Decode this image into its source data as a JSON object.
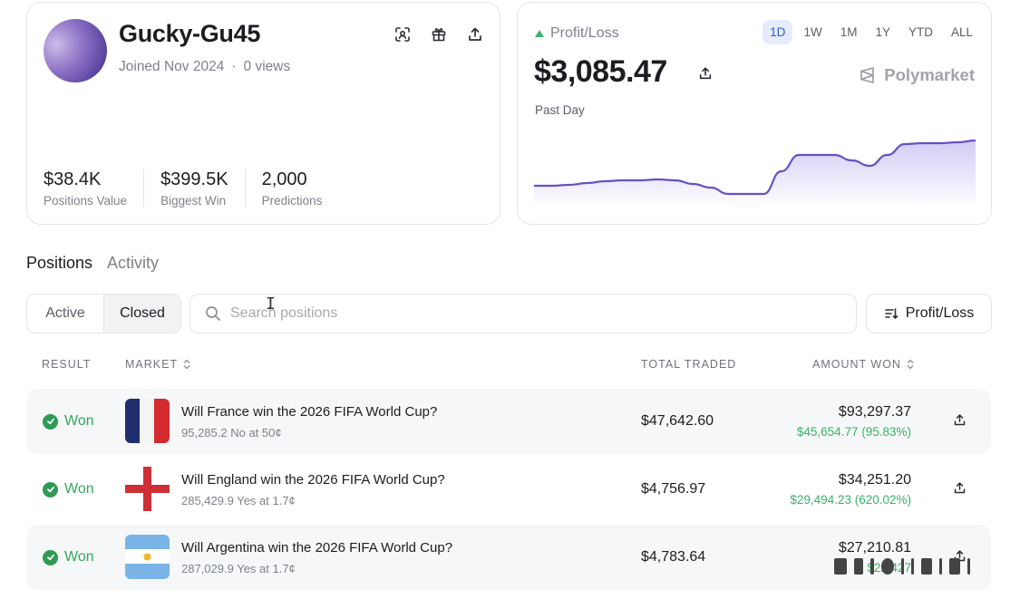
{
  "profile": {
    "username": "Gucky-Gu45",
    "joined": "Joined Nov 2024",
    "separator": "·",
    "views": "0 views",
    "header_icons": [
      "scan-icon",
      "gift-icon",
      "share-icon"
    ],
    "stats": [
      {
        "value": "$38.4K",
        "label": "Positions Value"
      },
      {
        "value": "$399.5K",
        "label": "Biggest Win"
      },
      {
        "value": "2,000",
        "label": "Predictions"
      }
    ]
  },
  "pnl": {
    "label": "Profit/Loss",
    "ranges": [
      "1D",
      "1W",
      "1M",
      "1Y",
      "YTD",
      "ALL"
    ],
    "active_range": "1D",
    "value": "$3,085.47",
    "period": "Past Day",
    "brand": "Polymarket",
    "line_color": "#6a4fc3",
    "sparkline": [
      24,
      24,
      25,
      27,
      29,
      30,
      30,
      31,
      30,
      26,
      22,
      15,
      15,
      15,
      40,
      58,
      58,
      58,
      52,
      46,
      58,
      70,
      71,
      71,
      72,
      74
    ]
  },
  "tabs": {
    "positions": "Positions",
    "activity": "Activity"
  },
  "filter": {
    "active": "Active",
    "closed": "Closed",
    "selected": "Closed"
  },
  "search": {
    "placeholder": "Search positions"
  },
  "sort": {
    "label": "Profit/Loss"
  },
  "table": {
    "headers": {
      "result": "RESULT",
      "market": "MARKET",
      "total_traded": "TOTAL TRADED",
      "amount_won": "AMOUNT WON"
    },
    "rows": [
      {
        "result": "Won",
        "flag": "france",
        "title": "Will France win the 2026 FIFA World Cup?",
        "sub": "95,285.2 No at 50¢",
        "traded": "$47,642.60",
        "won": "$93,297.37",
        "gain": "$45,654.77 (95.83%)"
      },
      {
        "result": "Won",
        "flag": "england",
        "title": "Will England win the 2026 FIFA World Cup?",
        "sub": "285,429.9 Yes at 1.7¢",
        "traded": "$4,756.97",
        "won": "$34,251.20",
        "gain": "$29,494.23 (620.02%)"
      },
      {
        "result": "Won",
        "flag": "argentina",
        "title": "Will Argentina win the 2026 FIFA World Cup?",
        "sub": "287,029.9 Yes at 1.7¢",
        "traded": "$4,783.64",
        "won": "$27,210.81",
        "gain": "$22,427"
      }
    ]
  },
  "colors": {
    "accent": "#2f5bd6",
    "won_green": "#33a65d",
    "gain_green": "#3bb26a"
  }
}
